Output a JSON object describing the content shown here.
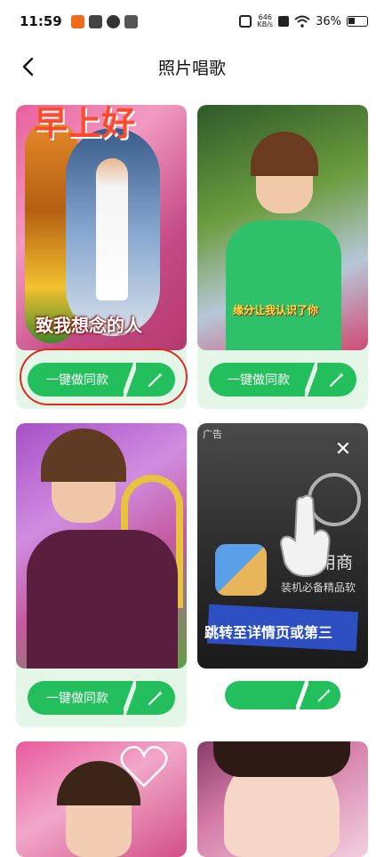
{
  "status_bar": {
    "time": "11:59",
    "net_speed_value": "646",
    "net_speed_unit": "KB/s",
    "battery": "36%"
  },
  "header": {
    "title": "照片唱歌"
  },
  "cards": [
    {
      "button_label": "一键做同款",
      "caption_top": "早上好",
      "caption_bottom": "致我想念的人"
    },
    {
      "button_label": "一键做同款",
      "caption": "缘分让我认识了你"
    },
    {
      "button_label": "一键做同款"
    },
    {
      "ad_tag": "广告",
      "app_text_1": "应用商",
      "app_text_2": "装机必备精品软",
      "cta_text": "跳转至详情页或第三"
    },
    {},
    {}
  ],
  "colors": {
    "accent": "#22bf5c",
    "card_bg": "#e4f6e8",
    "highlight": "#e0281c"
  },
  "icons": [
    "back-arrow-icon",
    "magic-wand-icon",
    "close-icon",
    "hand-pointer-icon"
  ]
}
